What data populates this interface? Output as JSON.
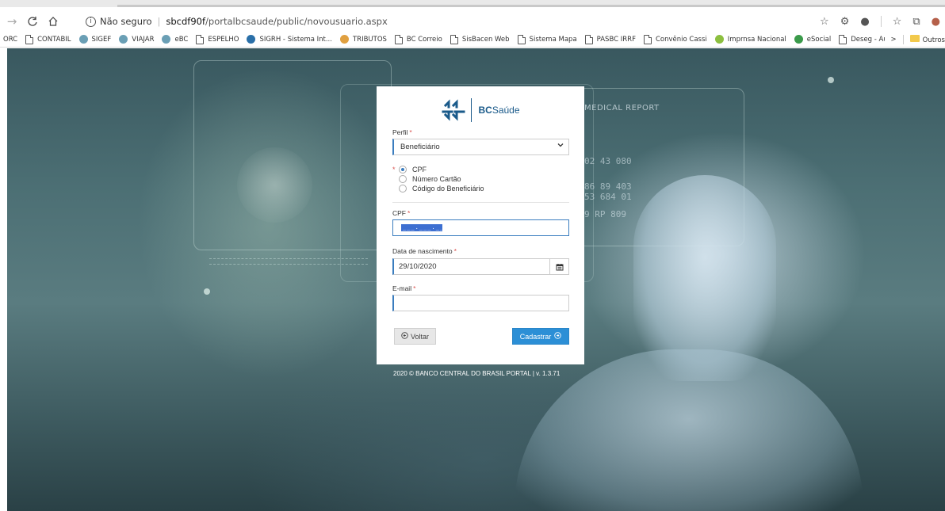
{
  "browser": {
    "url_info_label": "Não seguro",
    "url_host": "sbcdf90f",
    "url_path": "/portalbcsaude/public/novousuario.aspx",
    "bookmarks": [
      {
        "label": "ORC",
        "icon": "none"
      },
      {
        "label": "CONTABIL",
        "icon": "page-icon"
      },
      {
        "label": "SIGEF",
        "icon": "bc-icon"
      },
      {
        "label": "VIAJAR",
        "icon": "bc-icon"
      },
      {
        "label": "eBC",
        "icon": "bc-icon"
      },
      {
        "label": "ESPELHO",
        "icon": "page-icon"
      },
      {
        "label": "SIGRH - Sistema Int...",
        "icon": "sigrh-icon"
      },
      {
        "label": "TRIBUTOS",
        "icon": "tributos-icon"
      },
      {
        "label": "BC Correio",
        "icon": "page-icon"
      },
      {
        "label": "SisBacen Web",
        "icon": "page-icon"
      },
      {
        "label": "Sistema Mapa",
        "icon": "page-icon"
      },
      {
        "label": "PASBC IRRF",
        "icon": "page-icon"
      },
      {
        "label": "Convênio Cassi",
        "icon": "page-icon"
      },
      {
        "label": "Imprnsa Nacional",
        "icon": "imprensa-icon"
      },
      {
        "label": "eSocial",
        "icon": "esocial-icon"
      },
      {
        "label": "Deseg - Autorizaçã...",
        "icon": "page-icon"
      }
    ],
    "bookmarks_more": ">",
    "other_bookmarks": "Outros"
  },
  "background": {
    "medical_report_label": "MEDICAL REPORT",
    "readouts": [
      "02 43 080",
      "86 89 403",
      "53 684 01",
      "9 RP 809"
    ]
  },
  "form": {
    "logo_bc": "BC",
    "logo_saude": "Saúde",
    "perfil_label": "Perfil",
    "perfil_value": "Beneficiário",
    "id_options": [
      {
        "label": "CPF",
        "selected": true
      },
      {
        "label": "Número Cartão",
        "selected": false
      },
      {
        "label": "Código do Beneficiário",
        "selected": false
      }
    ],
    "cpf_label": "CPF",
    "cpf_mask": "___.___.___-__",
    "birth_label": "Data de nascimento",
    "birth_value": "29/10/2020",
    "email_label": "E-mail",
    "email_value": "",
    "required_mark": "*",
    "back_button": "Voltar",
    "submit_button": "Cadastrar"
  },
  "footer": {
    "text": "2020 © BANCO CENTRAL DO BRASIL PORTAL | v. 1.3.71"
  },
  "colors": {
    "accent": "#2c8fd6",
    "required": "#d9534f",
    "brand": "#1a5a8a"
  }
}
